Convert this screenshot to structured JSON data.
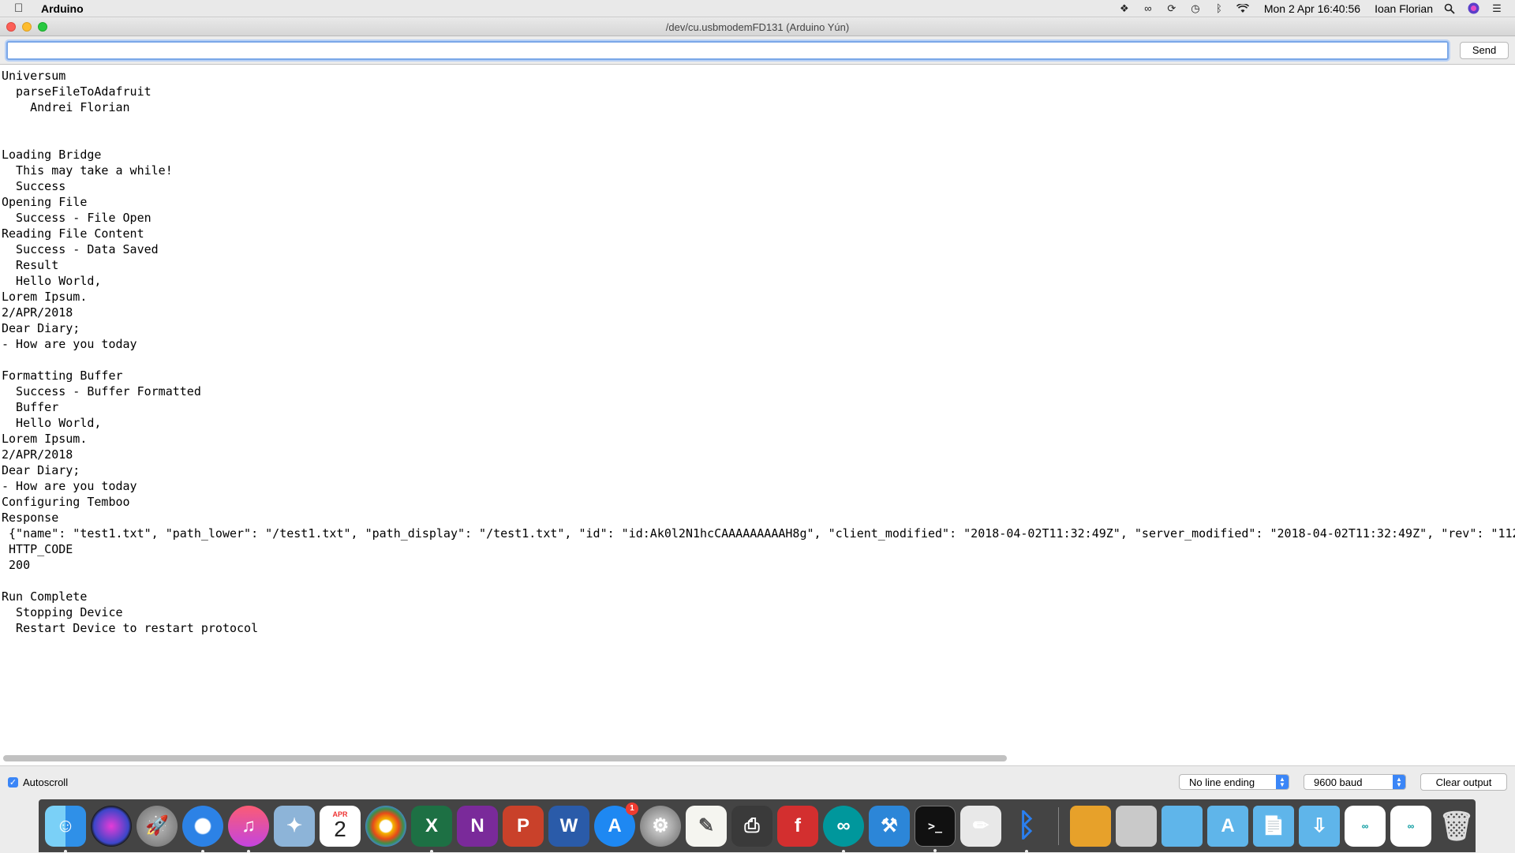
{
  "menubar": {
    "app_name": "Arduino",
    "datetime": "Mon 2 Apr  16:40:56",
    "user": "Ioan Florian",
    "icons": [
      "dropbox-icon",
      "infinity-icon",
      "sync-icon",
      "time-machine-icon",
      "bluetooth-icon",
      "wifi-icon",
      "search-icon",
      "siri-icon",
      "list-icon"
    ]
  },
  "window": {
    "title": "/dev/cu.usbmodemFD131 (Arduino Yún)"
  },
  "input": {
    "value": "",
    "send_label": "Send"
  },
  "output_lines": [
    "Universum",
    "  parseFileToAdafruit",
    "    Andrei Florian",
    "",
    "",
    "Loading Bridge",
    "  This may take a while!",
    "  Success",
    "Opening File",
    "  Success - File Open",
    "Reading File Content",
    "  Success - Data Saved",
    "  Result",
    "  Hello World,",
    "Lorem Ipsum.",
    "2/APR/2018",
    "Dear Diary;",
    "- How are you today",
    "",
    "Formatting Buffer",
    "  Success - Buffer Formatted",
    "  Buffer",
    "  Hello World,",
    "Lorem Ipsum.",
    "2/APR/2018",
    "Dear Diary;",
    "- How are you today",
    "Configuring Temboo",
    "Response",
    " {\"name\": \"test1.txt\", \"path_lower\": \"/test1.txt\", \"path_display\": \"/test1.txt\", \"id\": \"id:Ak0l2N1hcCAAAAAAAAAH8g\", \"client_modified\": \"2018-04-02T11:32:49Z\", \"server_modified\": \"2018-04-02T11:32:49Z\", \"rev\": \"112",
    " HTTP_CODE",
    " 200",
    "",
    "Run Complete",
    "  Stopping Device",
    "  Restart Device to restart protocol"
  ],
  "bottom": {
    "autoscroll_label": "Autoscroll",
    "autoscroll_checked": true,
    "line_ending": "No line ending",
    "baud": "9600 baud",
    "clear_label": "Clear output"
  },
  "dock": {
    "calendar_month": "APR",
    "calendar_day": "2",
    "appstore_badge": "1",
    "apps": [
      "finder",
      "siri",
      "launchpad",
      "safari",
      "itunes",
      "preview",
      "calendar",
      "photos",
      "excel",
      "onenote",
      "powerpoint",
      "word",
      "app-store",
      "system-preferences",
      "textedit",
      "printer",
      "fritzing",
      "arduino",
      "xcode",
      "terminal",
      "script-editor",
      "bluetooth-file-exchange",
      "underscore-disk",
      "disk",
      "folder",
      "applications-folder",
      "documents-folder",
      "downloads-folder",
      "arduino-window-1",
      "arduino-window-2",
      "trash"
    ]
  }
}
